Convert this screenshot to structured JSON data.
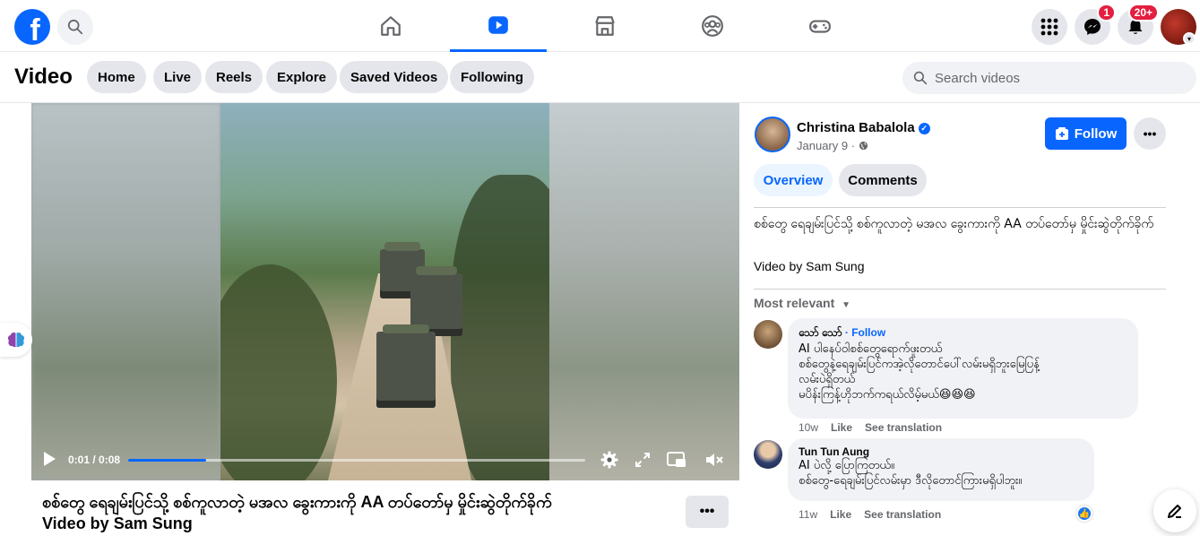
{
  "topnav": {
    "logo_letter": "f",
    "tabs": [
      {
        "name": "home-icon"
      },
      {
        "name": "video-icon",
        "active": true
      },
      {
        "name": "marketplace-icon"
      },
      {
        "name": "groups-icon"
      },
      {
        "name": "gaming-icon"
      }
    ],
    "messenger_badge": "1",
    "notifications_badge": "20+",
    "accent": "#0866ff"
  },
  "subnav": {
    "title": "Video",
    "pills": [
      "Home",
      "Live",
      "Reels",
      "Explore",
      "Saved Videos",
      "Following"
    ],
    "search_placeholder": "Search videos"
  },
  "video": {
    "time": "0:01 / 0:08",
    "progress_fraction": 0.17,
    "title_line1": "စစ်တွေ ရေချမ်းပြင်သို့ စစ်ကူလာတဲ့ မအလ ခွေးကားကို AA တပ်တော်မှ မှိုင်းဆွဲတိုက်ခိုက်",
    "title_line2": "Video by Sam Sung"
  },
  "post": {
    "author": "Christina Babalola",
    "date": "January 9",
    "follow_label": "Follow",
    "tab_overview": "Overview",
    "tab_comments": "Comments",
    "description": "စစ်တွေ ရေချမ်းပြင်သို့ စစ်ကူလာတဲ့ မအလ ခွေးကားကို AA တပ်တော်မှ မှိုင်းဆွဲတိုက်ခိုက်",
    "credit": "Video by Sam Sung",
    "sort_label": "Most relevant"
  },
  "comments": [
    {
      "name": "သော် သော်",
      "follow": "Follow",
      "lines": [
        "AI ပါနေပ်ဝါစစ်တွေရောက်ဖူးတယ်",
        "စစ်တွေနဲ့ရေချမ်းပြင်ကအဲ့လိုတောင်ပေါ်လမ်းမရှိဘူးမြေပြန့်",
        "လမ်းပဲရှိတယ်",
        "မပိန်းကြန့်ဟိုဘက်ကရယ်လိမ့်မယ်😆😆😆"
      ],
      "time": "10w",
      "like": "Like",
      "translate": "See translation"
    },
    {
      "name": "Tun Tun Aung",
      "lines": [
        "AI ပဲလို့ ပြောကြတယ်။",
        "စစ်တွေ-ရေချမ်းပြင်လမ်းမှာ ဒီလိုတောင်ကြားမရှိပါဘူး။"
      ],
      "time": "11w",
      "like": "Like",
      "translate": "See translation"
    }
  ]
}
